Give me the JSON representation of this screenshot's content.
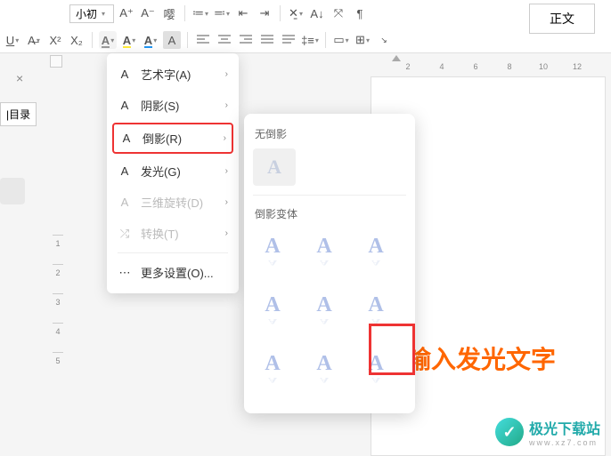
{
  "toolbar": {
    "font_size_label": "小初",
    "zhengwen": "正文"
  },
  "ruler_h": [
    "2",
    "4",
    "6",
    "8",
    "10",
    "12"
  ],
  "ruler_v": [
    "1",
    "2",
    "3",
    "4",
    "5"
  ],
  "tab": {
    "close_icon": "×",
    "mulu_label": "|目录"
  },
  "menu": {
    "items": [
      {
        "label": "艺术字(A)"
      },
      {
        "label": "阴影(S)"
      },
      {
        "label": "倒影(R)"
      },
      {
        "label": "发光(G)"
      },
      {
        "label": "三维旋转(D)"
      },
      {
        "label": "转换(T)"
      },
      {
        "label": "更多设置(O)..."
      }
    ]
  },
  "submenu": {
    "title_none": "无倒影",
    "title_variants": "倒影变体"
  },
  "annotation": {
    "text": "输入发光文字"
  },
  "watermark": {
    "main": "极光下载站",
    "sub": "www.xz7.com"
  }
}
